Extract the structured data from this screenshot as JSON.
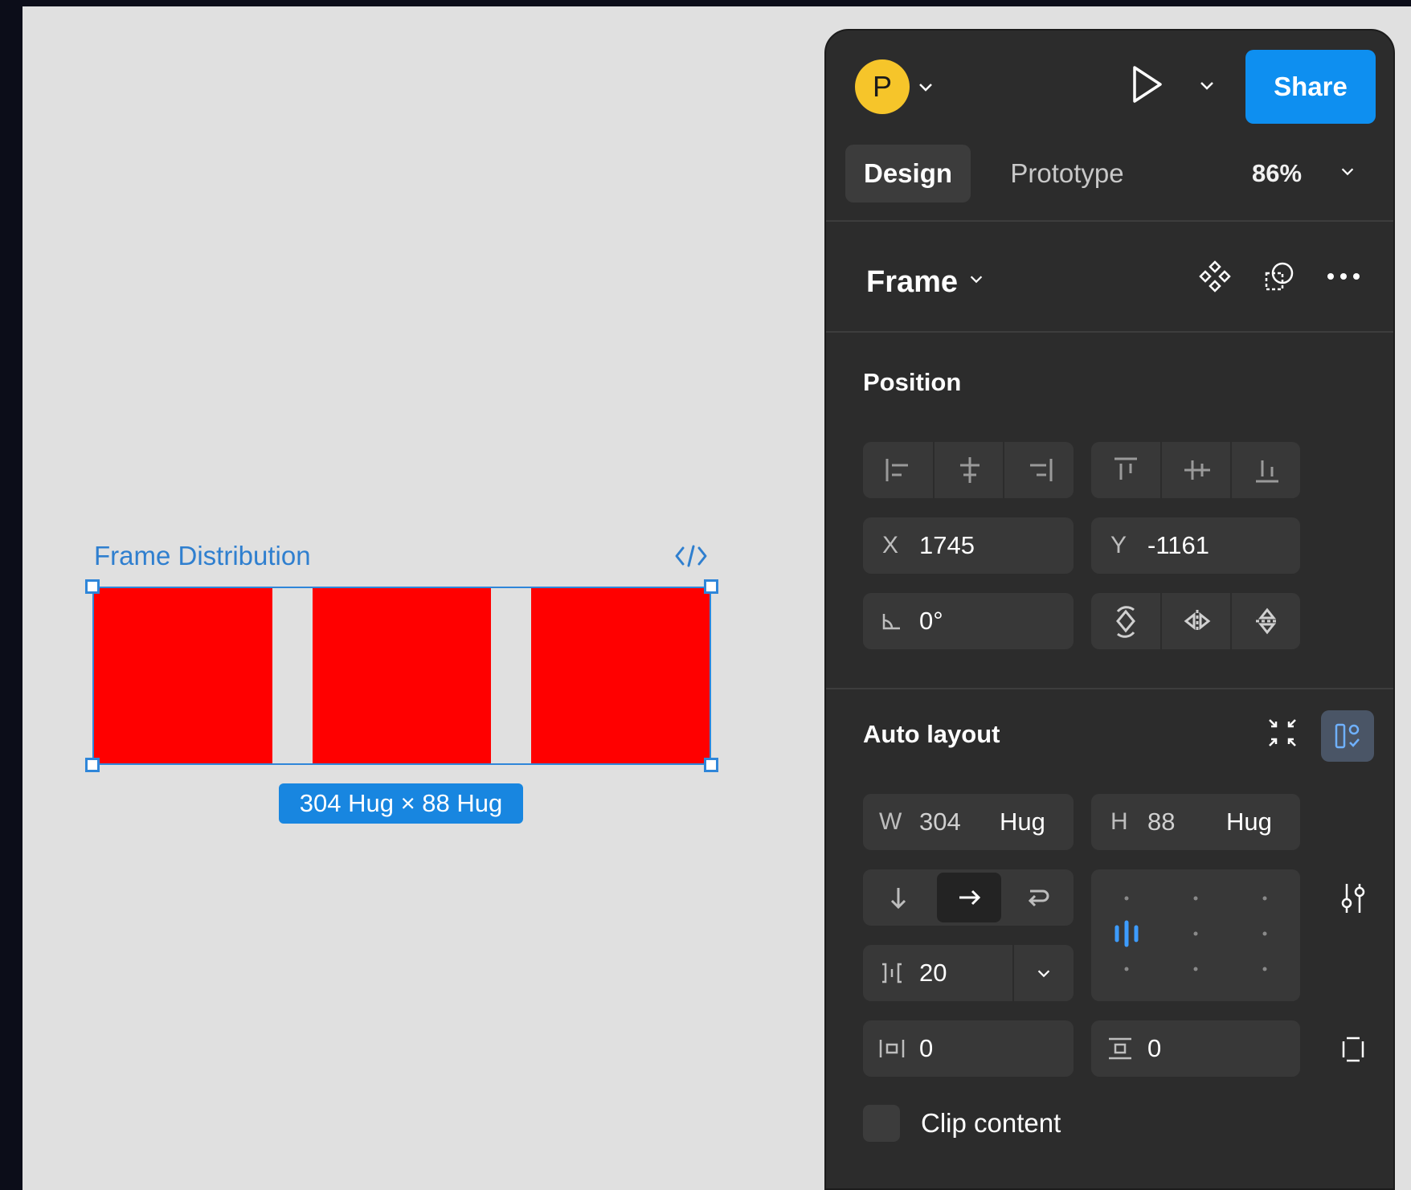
{
  "canvas": {
    "frame_name": "Frame Distribution",
    "size_label": "304 Hug × 88 Hug",
    "fill_color": "#ff0000",
    "selection_color": "#2f86d9"
  },
  "topbar": {
    "avatar_letter": "P",
    "share_label": "Share",
    "accent": "#0e8ff0"
  },
  "tabs": [
    {
      "label": "Design",
      "active": true
    },
    {
      "label": "Prototype",
      "active": false
    }
  ],
  "zoom": "86%",
  "layer": {
    "name": "Frame"
  },
  "position": {
    "title": "Position",
    "x_label": "X",
    "x_value": "1745",
    "y_label": "Y",
    "y_value": "-1161",
    "rotation_value": "0°"
  },
  "auto_layout": {
    "title": "Auto layout",
    "w_label": "W",
    "w_value": "304",
    "w_mode": "Hug",
    "h_label": "H",
    "h_value": "88",
    "h_mode": "Hug",
    "direction_selected": "horizontal",
    "gap_value": "20",
    "padding_h_value": "0",
    "padding_v_value": "0",
    "clip_label": "Clip content",
    "clip_checked": false
  },
  "icons": [
    "code-icon",
    "chevron-down-icon",
    "play-icon",
    "component-icon",
    "mask-icon",
    "more-icon",
    "align-left-icon",
    "align-center-h-icon",
    "align-right-icon",
    "align-top-icon",
    "align-middle-icon",
    "align-bottom-icon",
    "rotation-icon",
    "rotate-icon",
    "flip-horizontal-icon",
    "flip-vertical-icon",
    "collapse-icon",
    "layout-toggle-icon",
    "arrow-down-icon",
    "arrow-right-icon",
    "wrap-icon",
    "gap-icon",
    "settings-sliders-icon",
    "padding-h-icon",
    "padding-v-icon",
    "padding-individual-icon"
  ]
}
